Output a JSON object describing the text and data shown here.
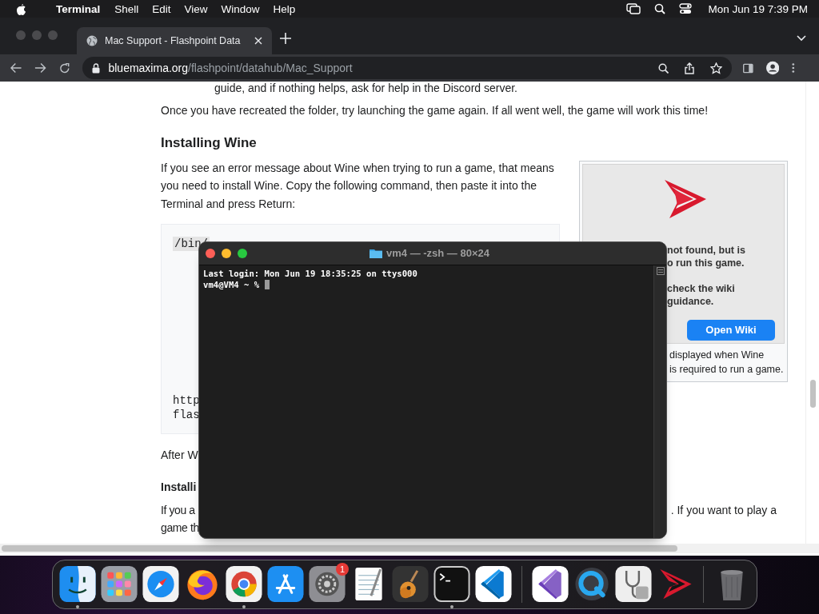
{
  "menu_bar": {
    "app_name": "Terminal",
    "menus": [
      "Shell",
      "Edit",
      "View",
      "Window",
      "Help"
    ],
    "clock": "Mon Jun 19  7:39 PM"
  },
  "browser": {
    "tabs": [
      {
        "title": "Mac Support - Flashpoint Data",
        "selected": true
      }
    ],
    "address": {
      "host": "bluemaxima.org",
      "path": "/flashpoint/datahub/Mac_Support"
    }
  },
  "page": {
    "list_tail": "guide, and if nothing helps, ask for help in the Discord server.",
    "paragraph_1": "Once you have recreated the folder, try launching the game again. If all went well, the game will work this time!",
    "heading_1": "Installing Wine",
    "paragraph_2": "If you see an error message about Wine when trying to run a game, that means you need to install Wine. Copy the following command, then paste it into the Terminal and press Return:",
    "code_first": "/bin/",
    "code_last": [
      "http",
      "flas"
    ],
    "figure": {
      "dialog_lines": [
        "not found, but is",
        "o run this game.",
        "check the wiki",
        "guidance."
      ],
      "dialog_button": "Open Wiki",
      "caption_lines": [
        "displayed when Wine",
        "is required to run a game."
      ]
    },
    "paragraph_3": "After W",
    "heading_2": "Installi",
    "paragraph_4_start": [
      "If you a",
      "game th"
    ],
    "paragraph_4_end": ". If you want to play a"
  },
  "terminal": {
    "title": "vm4 — -zsh — 80×24",
    "lines": [
      "Last login: Mon Jun 19 18:35:25 on ttys000",
      "vm4@VM4 ~ % "
    ]
  },
  "dock": {
    "items": [
      {
        "kind": "finder",
        "running": true
      },
      {
        "kind": "launchpad",
        "running": false
      },
      {
        "kind": "safari",
        "running": false
      },
      {
        "kind": "firefox",
        "running": false
      },
      {
        "kind": "chrome",
        "running": true
      },
      {
        "kind": "appstore",
        "running": false
      },
      {
        "kind": "settings",
        "running": false,
        "badge": "1"
      },
      {
        "kind": "textedit",
        "running": false
      },
      {
        "kind": "garageband",
        "running": false
      },
      {
        "kind": "terminal",
        "running": true
      },
      {
        "kind": "vscode",
        "running": false
      },
      {
        "kind": "divider"
      },
      {
        "kind": "visualstudio",
        "running": false
      },
      {
        "kind": "quicktime",
        "running": false
      },
      {
        "kind": "diskutility",
        "running": false
      },
      {
        "kind": "flashpoint",
        "running": false
      },
      {
        "kind": "divider"
      },
      {
        "kind": "trash",
        "running": false
      }
    ]
  }
}
